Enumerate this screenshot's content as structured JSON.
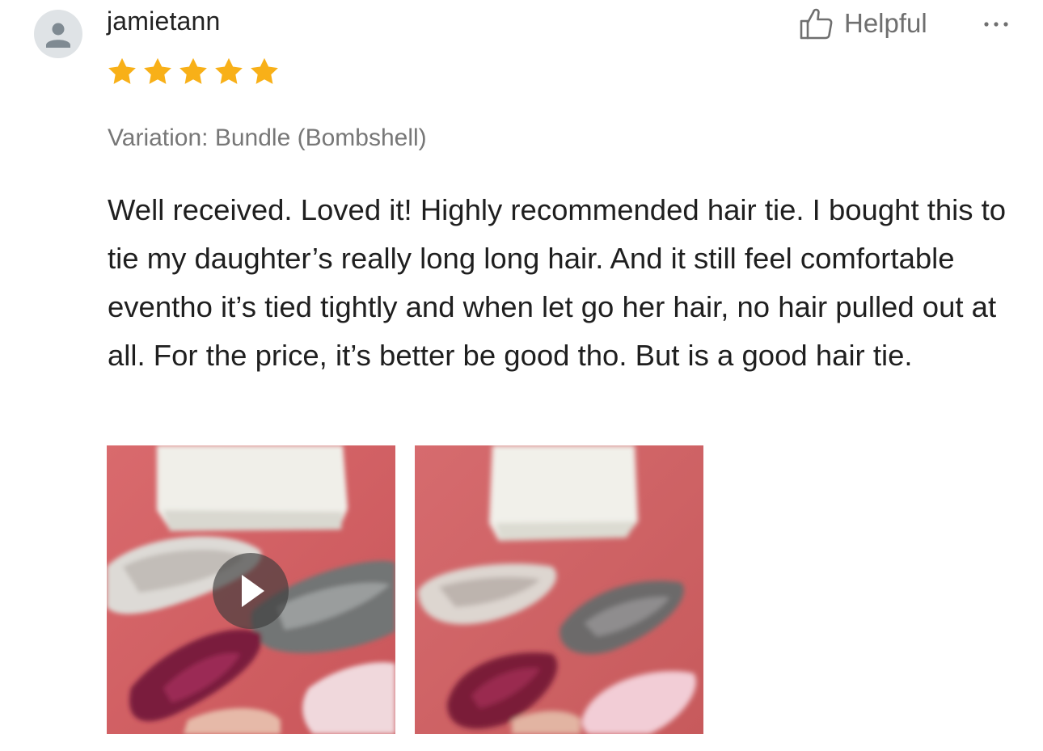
{
  "review": {
    "username": "jamietann",
    "rating": 5,
    "rating_max": 5,
    "variation": "Variation: Bundle (Bombshell)",
    "text": "Well received. Loved it! Highly recommended hair tie. I bought this to tie my daughter’s really long long hair. And it still feel comfortable eventho it’s tied tightly and when let go her hair, no hair pulled out at all. For the price, it’s better be good tho. But is a good hair tie."
  },
  "actions": {
    "helpful_label": "Helpful",
    "helpful_icon": "thumbs-up-icon",
    "more_icon": "more-options-icon"
  },
  "media": [
    {
      "type": "video",
      "icon": "play-icon"
    },
    {
      "type": "image"
    }
  ],
  "colors": {
    "star": "#f8b018",
    "meta_text": "#777777",
    "avatar_bg": "#dfe3e6",
    "avatar_fg": "#7f8a92"
  }
}
